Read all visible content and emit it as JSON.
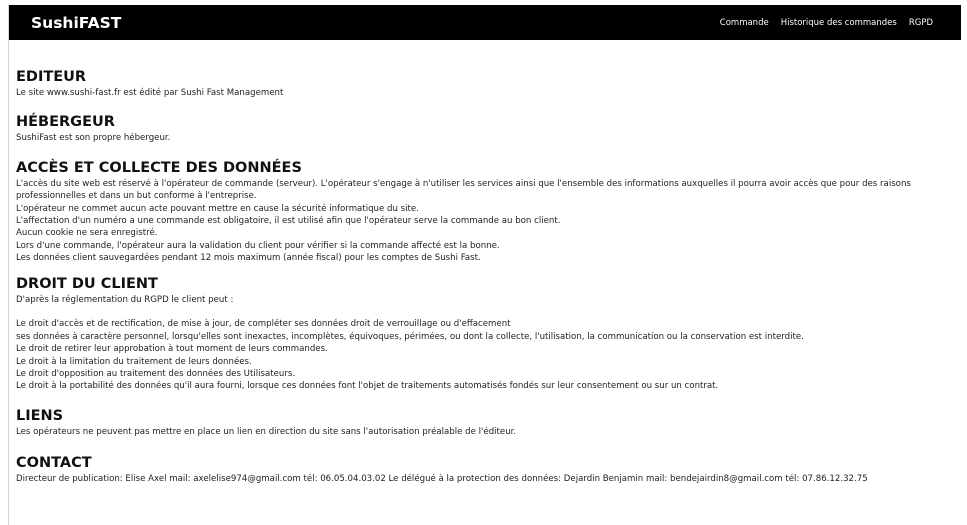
{
  "navbar": {
    "brand": "SushiFAST",
    "links": [
      "Commande",
      "Historique des commandes",
      "RGPD"
    ]
  },
  "sections": {
    "editeur": {
      "title": "EDITEUR",
      "lines": [
        "Le site www.sushi-fast.fr est édité par Sushi Fast Management"
      ]
    },
    "hebergeur": {
      "title": "HÉBERGEUR",
      "lines": [
        "SushiFast est son propre hébergeur."
      ]
    },
    "acces": {
      "title": "ACCÈS ET COLLECTE DES DONNÉES",
      "lines": [
        "L'accès du site web est réservé à l'opérateur de commande (serveur). L'opérateur s'engage à n'utiliser les services ainsi que l'ensemble des informations auxquelles il pourra avoir accès que pour des raisons professionnelles et dans un but conforme à l'entreprise.",
        "L'opérateur ne commet aucun acte pouvant mettre en cause la sécurité informatique du site.",
        "L'affectation d'un numéro a une commande est obligatoire, il est utilisé afin que l'opérateur serve la commande au bon client.",
        "Aucun cookie ne sera enregistré.",
        "Lors d'une commande, l'opérateur aura la validation du client pour vérifier si la commande affecté est la bonne.",
        "Les données client sauvegardées pendant 12 mois maximum (année fiscal) pour les comptes de Sushi Fast."
      ]
    },
    "droit": {
      "title": "DROIT DU CLIENT",
      "intro": "D'après la réglementation du RGPD le client peut :",
      "lines": [
        "Le droit d'accès et de rectification, de mise à jour, de compléter ses données droit de verrouillage ou d'effacement",
        "ses données à caractère personnel, lorsqu'elles sont inexactes, incomplètes, équivoques, périmées, ou dont la collecte, l'utilisation, la communication ou la conservation est interdite.",
        "Le droit de retirer leur approbation à tout moment de leurs commandes.",
        "Le droit à la limitation du traitement de leurs données.",
        "Le droit d'opposition au traitement des données des Utilisateurs.",
        "Le droit à la portabilité des données qu'il aura fourni, lorsque ces données font l'objet de traitements automatisés fondés sur leur consentement ou sur un contrat."
      ]
    },
    "liens": {
      "title": "LIENS",
      "lines": [
        "Les opérateurs ne peuvent pas mettre en place un lien en direction du site sans l'autorisation préalable de l'éditeur."
      ]
    },
    "contact": {
      "title": "CONTACT",
      "lines": [
        "Directeur de publication: Elise Axel mail: axelelise974@gmail.com tél: 06.05.04.03.02 Le délégué à la protection des données: Dejardin Benjamin mail: bendejairdin8@gmail.com tél: 07.86.12.32.75"
      ]
    }
  }
}
